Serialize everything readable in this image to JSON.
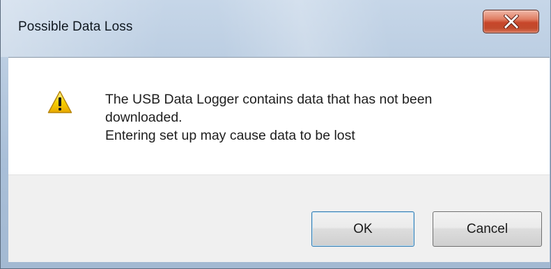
{
  "window": {
    "title": "Possible Data Loss",
    "close_icon": "close-x-icon"
  },
  "dialog": {
    "icon": "warning-icon",
    "message_lines": [
      "The USB Data Logger contains data that has not been",
      "downloaded.",
      "Entering set up may cause data to be lost"
    ]
  },
  "buttons": {
    "ok_label": "OK",
    "cancel_label": "Cancel"
  },
  "colors": {
    "close_button": "#c7462a",
    "warning_yellow": "#f5c400",
    "default_button_border": "#3c7fb1"
  }
}
